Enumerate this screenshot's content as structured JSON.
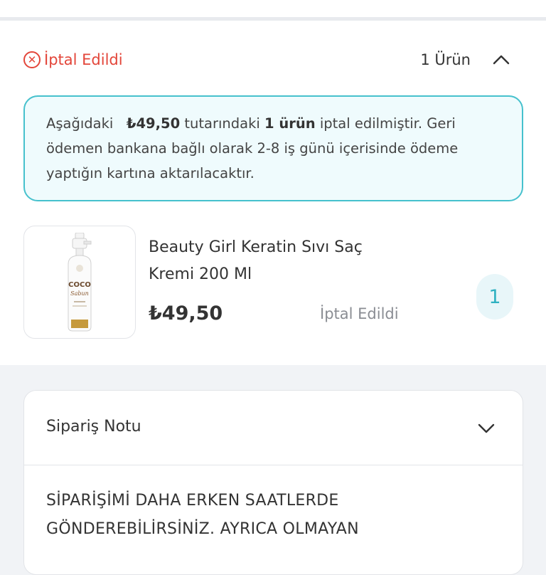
{
  "status": {
    "title": "İptal Edildi",
    "item_count": "1 Ürün"
  },
  "info": {
    "prefix": "Aşağıdaki",
    "amount": "₺49,50",
    "mid": "tutarındaki",
    "count": "1 ürün",
    "suffix": "iptal edilmiştir. Geri ödemen bankana bağlı olarak 2-8 iş günü içerisinde ödeme yaptığın kartına aktarılacaktır."
  },
  "product": {
    "name": "Beauty Girl Keratin Sıvı Saç Kremi 200 Ml",
    "price": "₺49,50",
    "status": "İptal Edildi",
    "quantity": "1",
    "label_brand": "COCO",
    "label_sub": "Sabun"
  },
  "note": {
    "title": "Sipariş Notu",
    "text": "SİPARİŞİMİ DAHA ERKEN SAATLERDE GÖNDEREBİLİRSİNİZ. AYRICA OLMAYAN"
  },
  "colors": {
    "cancel_red": "#e3463a",
    "accent_teal": "#46c1cd"
  }
}
